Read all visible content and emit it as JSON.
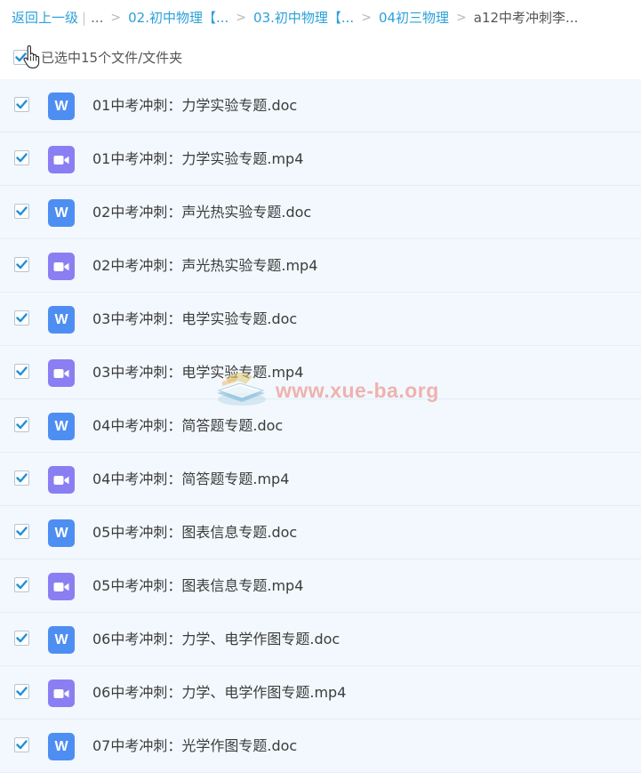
{
  "breadcrumb": {
    "back_label": "返回上一级",
    "pipe": "|",
    "ellipsis": "...",
    "separator": ">",
    "crumbs": [
      "02.初中物理【...",
      "03.初中物理【...",
      "04初三物理"
    ],
    "current": "a12中考冲刺李..."
  },
  "selection": {
    "label": "已选中15个文件/文件夹",
    "all_checked": true
  },
  "files": [
    {
      "name": "01中考冲刺：力学实验专题.doc",
      "type": "doc",
      "icon": "word-doc-icon",
      "icon_letter": "W",
      "checked": true
    },
    {
      "name": "01中考冲刺：力学实验专题.mp4",
      "type": "video",
      "icon": "video-camera-icon",
      "checked": true
    },
    {
      "name": "02中考冲刺：声光热实验专题.doc",
      "type": "doc",
      "icon": "word-doc-icon",
      "icon_letter": "W",
      "checked": true
    },
    {
      "name": "02中考冲刺：声光热实验专题.mp4",
      "type": "video",
      "icon": "video-camera-icon",
      "checked": true
    },
    {
      "name": "03中考冲刺：电学实验专题.doc",
      "type": "doc",
      "icon": "word-doc-icon",
      "icon_letter": "W",
      "checked": true
    },
    {
      "name": "03中考冲刺：电学实验专题.mp4",
      "type": "video",
      "icon": "video-camera-icon",
      "checked": true
    },
    {
      "name": "04中考冲刺：简答题专题.doc",
      "type": "doc",
      "icon": "word-doc-icon",
      "icon_letter": "W",
      "checked": true
    },
    {
      "name": "04中考冲刺：简答题专题.mp4",
      "type": "video",
      "icon": "video-camera-icon",
      "checked": true
    },
    {
      "name": "05中考冲刺：图表信息专题.doc",
      "type": "doc",
      "icon": "word-doc-icon",
      "icon_letter": "W",
      "checked": true
    },
    {
      "name": "05中考冲刺：图表信息专题.mp4",
      "type": "video",
      "icon": "video-camera-icon",
      "checked": true
    },
    {
      "name": "06中考冲刺：力学、电学作图专题.doc",
      "type": "doc",
      "icon": "word-doc-icon",
      "icon_letter": "W",
      "checked": true
    },
    {
      "name": "06中考冲刺：力学、电学作图专题.mp4",
      "type": "video",
      "icon": "video-camera-icon",
      "checked": true
    },
    {
      "name": "07中考冲刺：光学作图专题.doc",
      "type": "doc",
      "icon": "word-doc-icon",
      "icon_letter": "W",
      "checked": true
    }
  ],
  "watermark": {
    "text": "www.xue-ba.org",
    "icon": "book-logo-icon"
  },
  "colors": {
    "link": "#2aa0d8",
    "row_background": "#f2f8fd",
    "doc_icon": "#4e8ef2",
    "video_icon": "#8a7ef3",
    "check": "#1e90d6"
  }
}
